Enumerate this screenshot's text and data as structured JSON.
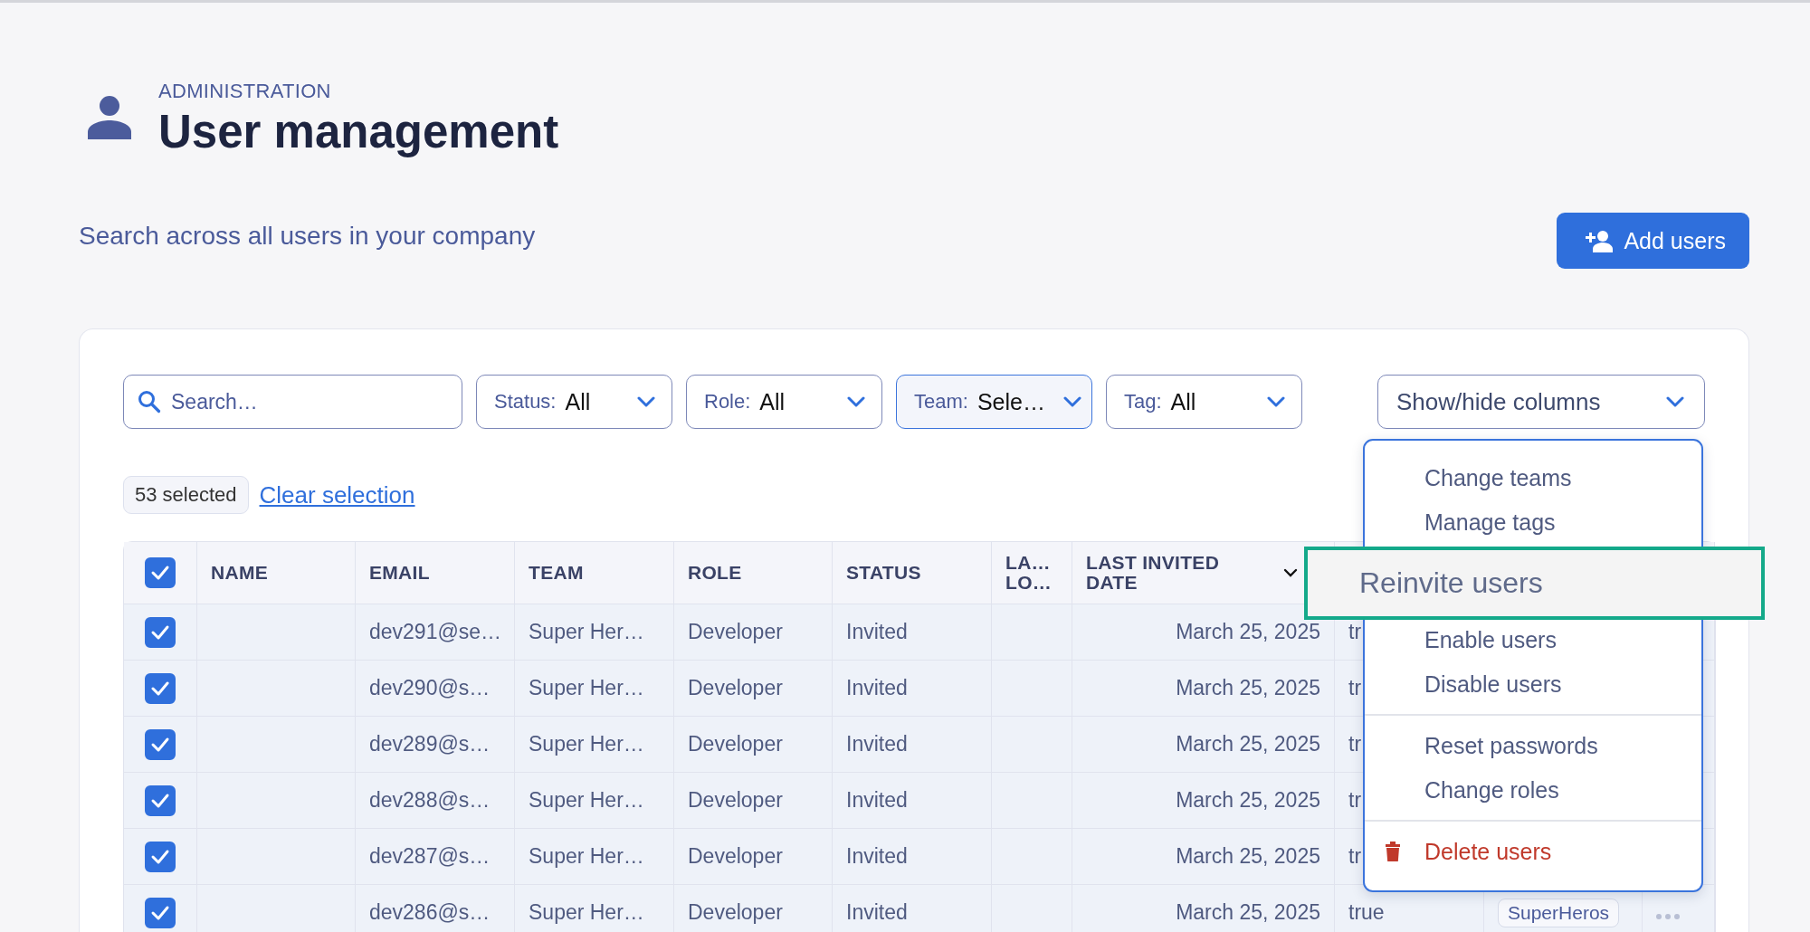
{
  "header": {
    "section": "ADMINISTRATION",
    "title": "User management",
    "subtitle": "Search across all users in your company"
  },
  "add_button": {
    "label": "Add users"
  },
  "search": {
    "placeholder": "Search…"
  },
  "filters": [
    {
      "label": "Status:",
      "value": "All",
      "active": false
    },
    {
      "label": "Role:",
      "value": "All",
      "active": false
    },
    {
      "label": "Team:",
      "value": "Sele…",
      "active": true
    },
    {
      "label": "Tag:",
      "value": "All",
      "active": false
    }
  ],
  "columns_toggle": {
    "label": "Show/hide columns"
  },
  "selection": {
    "count": "53 selected",
    "clear": "Clear selection"
  },
  "table": {
    "all_checked": true,
    "columns": [
      {
        "label": "NAME",
        "sorted": false
      },
      {
        "label": "EMAIL",
        "sorted": false
      },
      {
        "label": "TEAM",
        "sorted": false
      },
      {
        "label": "ROLE",
        "sorted": false
      },
      {
        "label": "STATUS",
        "sorted": false
      },
      {
        "label": "LA… LO…",
        "sorted": false
      },
      {
        "label": "LAST INVITED DATE",
        "sorted": true
      }
    ],
    "rows": [
      {
        "checked": true,
        "email": "dev291@se…",
        "team": "Super Her…",
        "role": "Developer",
        "status": "Invited",
        "last_invited": "March 25, 2025",
        "column_8": "tr"
      },
      {
        "checked": true,
        "email": "dev290@s…",
        "team": "Super Her…",
        "role": "Developer",
        "status": "Invited",
        "last_invited": "March 25, 2025",
        "column_8": "tr"
      },
      {
        "checked": true,
        "email": "dev289@s…",
        "team": "Super Her…",
        "role": "Developer",
        "status": "Invited",
        "last_invited": "March 25, 2025",
        "column_8": "tr"
      },
      {
        "checked": true,
        "email": "dev288@s…",
        "team": "Super Her…",
        "role": "Developer",
        "status": "Invited",
        "last_invited": "March 25, 2025",
        "column_8": "tr"
      },
      {
        "checked": true,
        "email": "dev287@s…",
        "team": "Super Her…",
        "role": "Developer",
        "status": "Invited",
        "last_invited": "March 25, 2025",
        "column_8": "tr"
      },
      {
        "checked": true,
        "email": "dev286@s…",
        "team": "Super Her…",
        "role": "Developer",
        "status": "Invited",
        "last_invited": "March 25, 2025",
        "column_8": "true",
        "tag": "SuperHeros"
      }
    ]
  },
  "menu": {
    "groups": [
      [
        {
          "label": "Change teams",
          "kind": "action",
          "highlighted": false
        },
        {
          "label": "Manage tags",
          "kind": "action",
          "highlighted": false
        },
        {
          "label": "Reinvite users",
          "kind": "action",
          "highlighted": true
        },
        {
          "label": "Enable users",
          "kind": "action",
          "highlighted": false
        },
        {
          "label": "Disable users",
          "kind": "action",
          "highlighted": false
        }
      ],
      [
        {
          "label": "Reset passwords",
          "kind": "action",
          "highlighted": false
        },
        {
          "label": "Change roles",
          "kind": "action",
          "highlighted": false
        }
      ],
      [
        {
          "label": "Delete users",
          "kind": "danger",
          "highlighted": false
        }
      ]
    ]
  }
}
